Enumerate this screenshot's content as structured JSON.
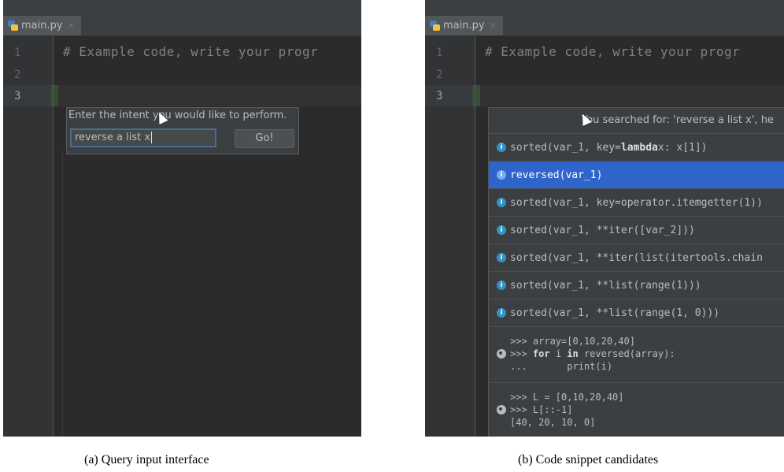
{
  "panel_a": {
    "tab_label": "main.py",
    "line_numbers": [
      "1",
      "2",
      "3"
    ],
    "code_line": "# Example code, write your progr",
    "dialog": {
      "label": "Enter the intent you would like to perform.",
      "input_value": "reverse a list x",
      "go_label": "Go!"
    }
  },
  "panel_b": {
    "tab_label": "main.py",
    "line_numbers": [
      "1",
      "2",
      "3"
    ],
    "code_line": "# Example code, write your progr",
    "popup": {
      "header": "You searched for: 'reverse a list x', he",
      "candidates": [
        {
          "pre": "sorted(var_1, key=",
          "kw": "lambda",
          "post": " x: x[1])",
          "selected": false
        },
        {
          "pre": "reversed(var_1)",
          "kw": "",
          "post": "",
          "selected": true
        },
        {
          "pre": "sorted(var_1, key=operator.itemgetter(1))",
          "kw": "",
          "post": "",
          "selected": false
        },
        {
          "pre": "sorted(var_1, **iter([var_2]))",
          "kw": "",
          "post": "",
          "selected": false
        },
        {
          "pre": "sorted(var_1, **iter(list(itertools.chain",
          "kw": "",
          "post": "",
          "selected": false
        },
        {
          "pre": "sorted(var_1, **list(range(1)))",
          "kw": "",
          "post": "",
          "selected": false
        },
        {
          "pre": "sorted(var_1, **list(range(1, 0)))",
          "kw": "",
          "post": "",
          "selected": false
        }
      ],
      "snippet1": {
        "l1": ">>> array=[0,10,20,40]",
        "l2_prompt": ">>> ",
        "l2_kw1": "for",
        "l2_mid": " i ",
        "l2_kw2": "in",
        "l2_rest": " reversed(array):",
        "l3": "...       print(i)"
      },
      "snippet2": {
        "l1": ">>> L = [0,10,20,40]",
        "l2": ">>> L[::-1]",
        "l3": "[40, 20, 10, 0]"
      }
    }
  },
  "captions": {
    "a": "(a) Query input interface",
    "b": "(b) Code snippet candidates"
  }
}
